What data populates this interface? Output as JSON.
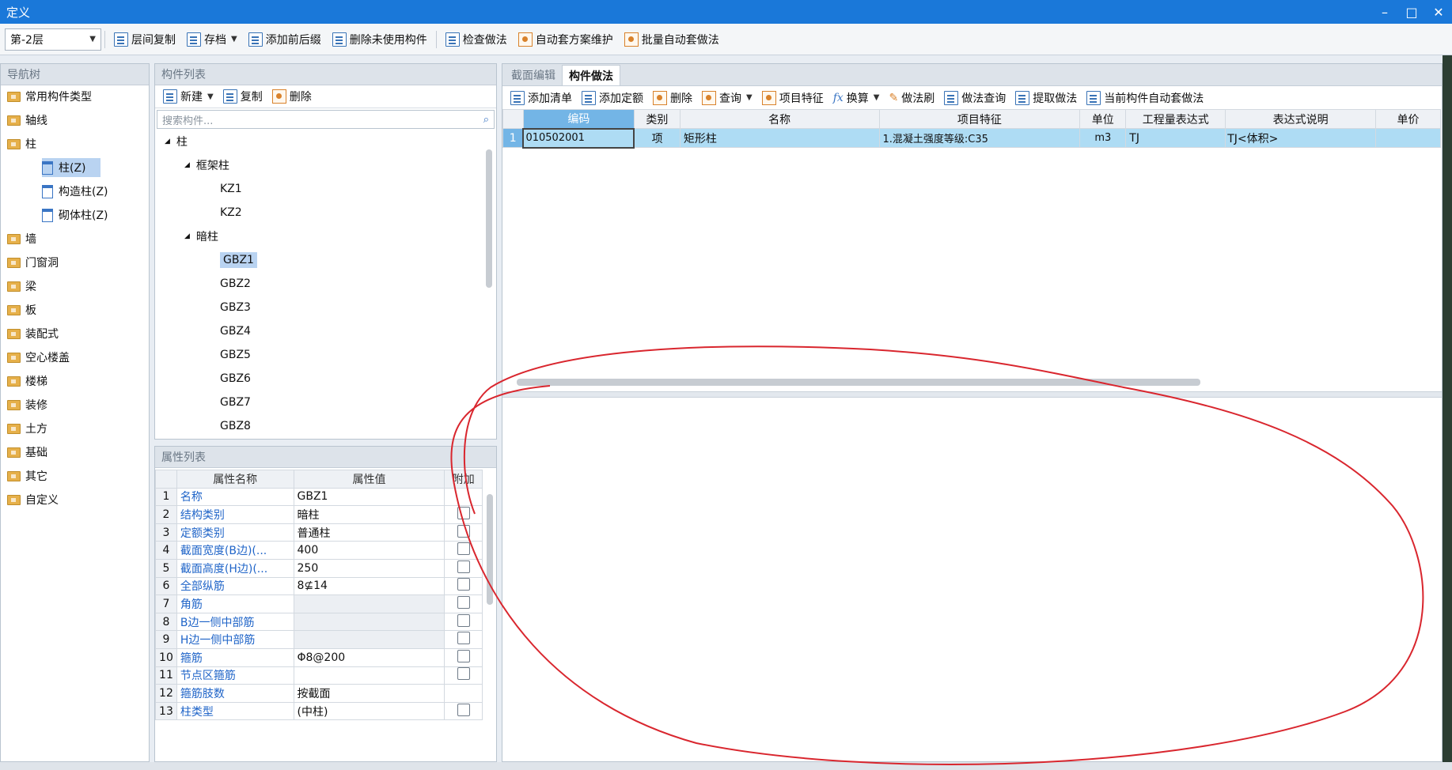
{
  "window": {
    "title": "定义",
    "minimize": "–",
    "maximize": "□",
    "close": "✕"
  },
  "toolbar": {
    "floor": "第-2层",
    "buttons": [
      "层间复制",
      "存档",
      "添加前后缀",
      "删除未使用构件",
      "检查做法",
      "自动套方案维护",
      "批量自动套做法"
    ]
  },
  "nav": {
    "header": "导航树",
    "items": [
      {
        "label": "常用构件类型",
        "level": 0
      },
      {
        "label": "轴线",
        "level": 0
      },
      {
        "label": "柱",
        "level": 0
      },
      {
        "label": "柱(Z)",
        "level": 1,
        "selected": true
      },
      {
        "label": "构造柱(Z)",
        "level": 1
      },
      {
        "label": "砌体柱(Z)",
        "level": 1
      },
      {
        "label": "墙",
        "level": 0
      },
      {
        "label": "门窗洞",
        "level": 0
      },
      {
        "label": "梁",
        "level": 0
      },
      {
        "label": "板",
        "level": 0
      },
      {
        "label": "装配式",
        "level": 0
      },
      {
        "label": "空心楼盖",
        "level": 0
      },
      {
        "label": "楼梯",
        "level": 0
      },
      {
        "label": "装修",
        "level": 0
      },
      {
        "label": "土方",
        "level": 0
      },
      {
        "label": "基础",
        "level": 0
      },
      {
        "label": "其它",
        "level": 0
      },
      {
        "label": "自定义",
        "level": 0
      }
    ]
  },
  "components": {
    "header": "构件列表",
    "actions": [
      "新建",
      "复制",
      "删除"
    ],
    "search_placeholder": "搜索构件...",
    "tree": [
      {
        "label": "柱",
        "level": 0,
        "expander": "◢"
      },
      {
        "label": "框架柱",
        "level": 1,
        "expander": "◢"
      },
      {
        "label": "KZ1",
        "level": 2
      },
      {
        "label": "KZ2",
        "level": 2
      },
      {
        "label": "暗柱",
        "level": 1,
        "expander": "◢"
      },
      {
        "label": "GBZ1",
        "level": 2,
        "selected": true
      },
      {
        "label": "GBZ2",
        "level": 2
      },
      {
        "label": "GBZ3",
        "level": 2
      },
      {
        "label": "GBZ4",
        "level": 2
      },
      {
        "label": "GBZ5",
        "level": 2
      },
      {
        "label": "GBZ6",
        "level": 2
      },
      {
        "label": "GBZ7",
        "level": 2
      },
      {
        "label": "GBZ8",
        "level": 2
      }
    ]
  },
  "properties": {
    "header": "属性列表",
    "columns": [
      "属性名称",
      "属性值",
      "附加"
    ],
    "rows": [
      {
        "no": "1",
        "name": "名称",
        "value": "GBZ1",
        "checkbox": false
      },
      {
        "no": "2",
        "name": "结构类别",
        "value": "暗柱",
        "checkbox": true
      },
      {
        "no": "3",
        "name": "定额类别",
        "value": "普通柱",
        "checkbox": true
      },
      {
        "no": "4",
        "name": "截面宽度(B边)(...",
        "value": "400",
        "checkbox": true
      },
      {
        "no": "5",
        "name": "截面高度(H边)(...",
        "value": "250",
        "checkbox": true
      },
      {
        "no": "6",
        "name": "全部纵筋",
        "value": "8⊈14",
        "checkbox": true
      },
      {
        "no": "7",
        "name": "角筋",
        "value": "",
        "checkbox": true,
        "gray": true
      },
      {
        "no": "8",
        "name": "B边一侧中部筋",
        "value": "",
        "checkbox": true,
        "gray": true
      },
      {
        "no": "9",
        "name": "H边一侧中部筋",
        "value": "",
        "checkbox": true,
        "gray": true
      },
      {
        "no": "10",
        "name": "箍筋",
        "value": "Φ8@200",
        "checkbox": true
      },
      {
        "no": "11",
        "name": "节点区箍筋",
        "value": "",
        "checkbox": true
      },
      {
        "no": "12",
        "name": "箍筋肢数",
        "value": "按截面",
        "checkbox": false
      },
      {
        "no": "13",
        "name": "柱类型",
        "value": "(中柱)",
        "checkbox": true
      }
    ]
  },
  "method": {
    "tabs": [
      "截面编辑",
      "构件做法"
    ],
    "active_tab": 1,
    "actions": [
      "添加清单",
      "添加定额",
      "删除",
      "查询",
      "项目特征",
      "换算",
      "做法刷",
      "做法查询",
      "提取做法",
      "当前构件自动套做法"
    ],
    "columns": [
      "编码",
      "类别",
      "名称",
      "项目特征",
      "单位",
      "工程量表达式",
      "表达式说明",
      "单价"
    ],
    "rows": [
      {
        "no": "1",
        "code": "010502001",
        "type": "项",
        "name": "矩形柱",
        "feature": "1.混凝土强度等级:C35",
        "unit": "m3",
        "expr": "TJ",
        "desc": "TJ<体积>",
        "price": ""
      }
    ]
  },
  "colors": {
    "titlebar": "#1a78d9",
    "selection": "#aedcf4",
    "annotation": "#d9262e"
  }
}
